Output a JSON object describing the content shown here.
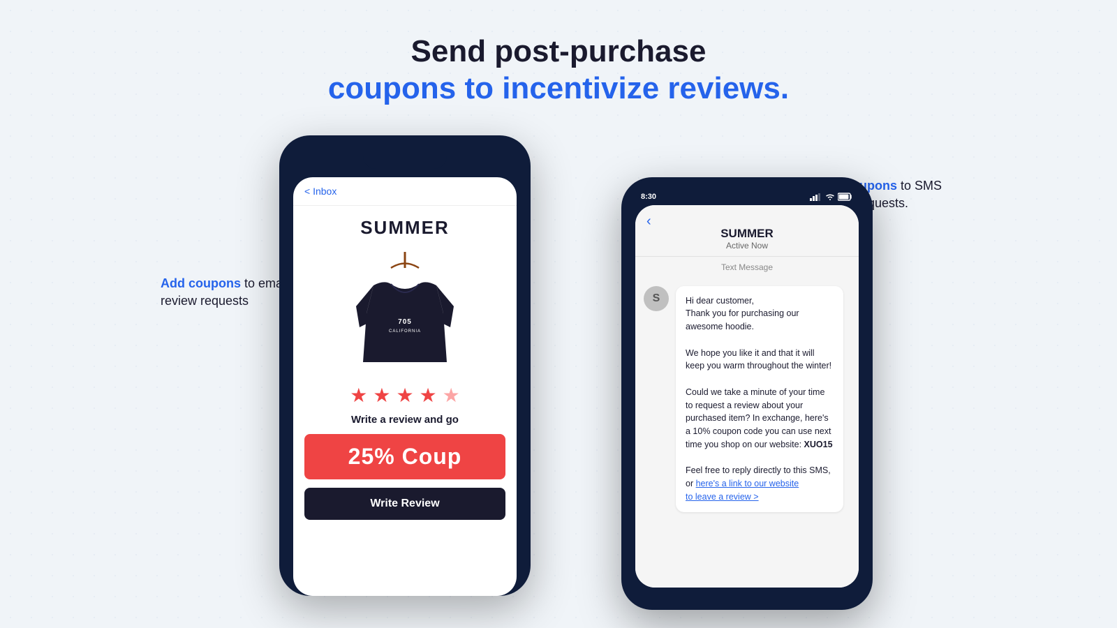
{
  "header": {
    "line1": "Send post-purchase",
    "line2": "coupons to incentivize reviews."
  },
  "left_callout": {
    "highlight": "Add coupons",
    "rest": " to email\nreview requests"
  },
  "right_callout": {
    "highlight": "Add coupons",
    "rest": " to SMS\nreview requests."
  },
  "email_phone": {
    "inbox_back": "< Inbox",
    "brand": "SUMMER",
    "stars": [
      "★",
      "★",
      "★",
      "★",
      "☆"
    ],
    "review_text": "Write a review and go",
    "coupon_text": "25% Coup",
    "write_review_btn": "Write Review"
  },
  "sms_phone": {
    "time": "8:30",
    "brand_name": "SUMMER",
    "active_status": "Active Now",
    "label": "Text Message",
    "avatar_letter": "S",
    "message_lines": [
      "Hi dear customer,",
      "Thank you for purchasing our awesome hoodie.",
      "",
      "We hope you like it and that it will keep you warm throughout the winter!",
      "",
      "Could we take a minute of your time to request a review about your purchased item? In exchange, here's a 10% coupon code you can use next time you shop on our website: XUO15",
      "",
      "Feel free to reply directly to this SMS, or here's a link to our website to leave a review >"
    ],
    "link_text": "here's a link to our website",
    "leave_review": "tO leave review >"
  }
}
